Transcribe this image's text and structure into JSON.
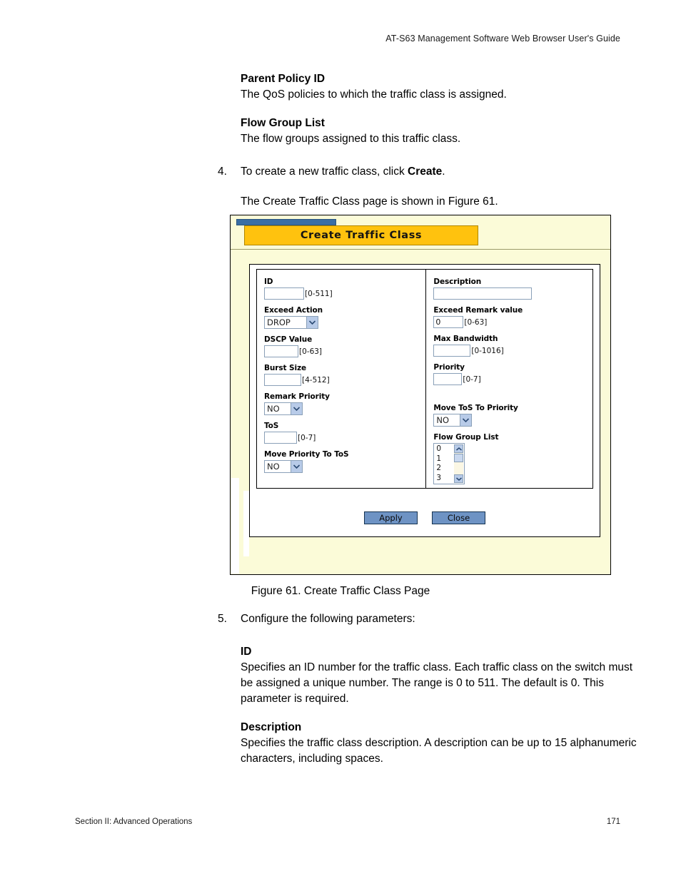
{
  "header": {
    "running_head": "AT-S63 Management Software Web Browser User's Guide"
  },
  "content_upper": {
    "terms": [
      {
        "term": "Parent Policy ID",
        "definition": "The QoS policies to which the traffic class is assigned."
      },
      {
        "term": "Flow Group List",
        "definition": "The flow groups assigned to this traffic class."
      }
    ],
    "step": {
      "number": "4.",
      "text_before": "To create a new traffic class, click ",
      "bold_word": "Create",
      "text_after": ".",
      "followup": "The Create Traffic Class page is shown in Figure 61."
    }
  },
  "figure": {
    "caption": "Figure 61. Create Traffic Class Page",
    "window_title": "Create Traffic Class",
    "colors": {
      "tab_gold": "#ffc20e",
      "title_blue": "#3a6ea5",
      "panel_cream": "#fbfbd8",
      "button_blue": "#6e93c4",
      "input_border": "#8aa0b8"
    },
    "left_column": [
      {
        "label": "ID",
        "type": "text",
        "value": "",
        "range": "[0-511]"
      },
      {
        "label": "Exceed Action",
        "type": "select",
        "value": "DROP",
        "range": ""
      },
      {
        "label": "DSCP Value",
        "type": "text",
        "value": "",
        "range": "[0-63]"
      },
      {
        "label": "Burst Size",
        "type": "text",
        "value": "",
        "range": "[4-512]"
      },
      {
        "label": "Remark Priority",
        "type": "select",
        "value": "NO",
        "range": ""
      },
      {
        "label": "ToS",
        "type": "text",
        "value": "",
        "range": "[0-7]"
      },
      {
        "label": "Move Priority To ToS",
        "type": "select",
        "value": "NO",
        "range": ""
      }
    ],
    "right_column": [
      {
        "label": "Description",
        "type": "text",
        "value": "",
        "range": ""
      },
      {
        "label": "Exceed Remark value",
        "type": "text",
        "value": "0",
        "range": "[0-63]"
      },
      {
        "label": "Max Bandwidth",
        "type": "text",
        "value": "",
        "range": "[0-1016]"
      },
      {
        "label": "Priority",
        "type": "text",
        "value": "",
        "range": "[0-7]"
      },
      {
        "label": "Move ToS To Priority",
        "type": "select",
        "value": "NO",
        "range": ""
      },
      {
        "label": "Flow Group List",
        "type": "listbox",
        "options": [
          "0",
          "1",
          "2",
          "3"
        ],
        "range": ""
      }
    ],
    "buttons": {
      "apply": "Apply",
      "close": "Close"
    }
  },
  "content_lower": {
    "step": {
      "number": "5.",
      "text": "Configure the following parameters:"
    },
    "terms": [
      {
        "term": "ID",
        "definition": "Specifies an ID number for the traffic class. Each traffic class on the switch must be assigned a unique number. The range is 0 to 511. The default is 0. This parameter is required."
      },
      {
        "term": "Description",
        "definition": "Specifies the traffic class description. A description can be up to 15 alphanumeric characters, including spaces."
      }
    ]
  },
  "footer": {
    "section": "Section II: Advanced Operations",
    "page_number": "171"
  }
}
